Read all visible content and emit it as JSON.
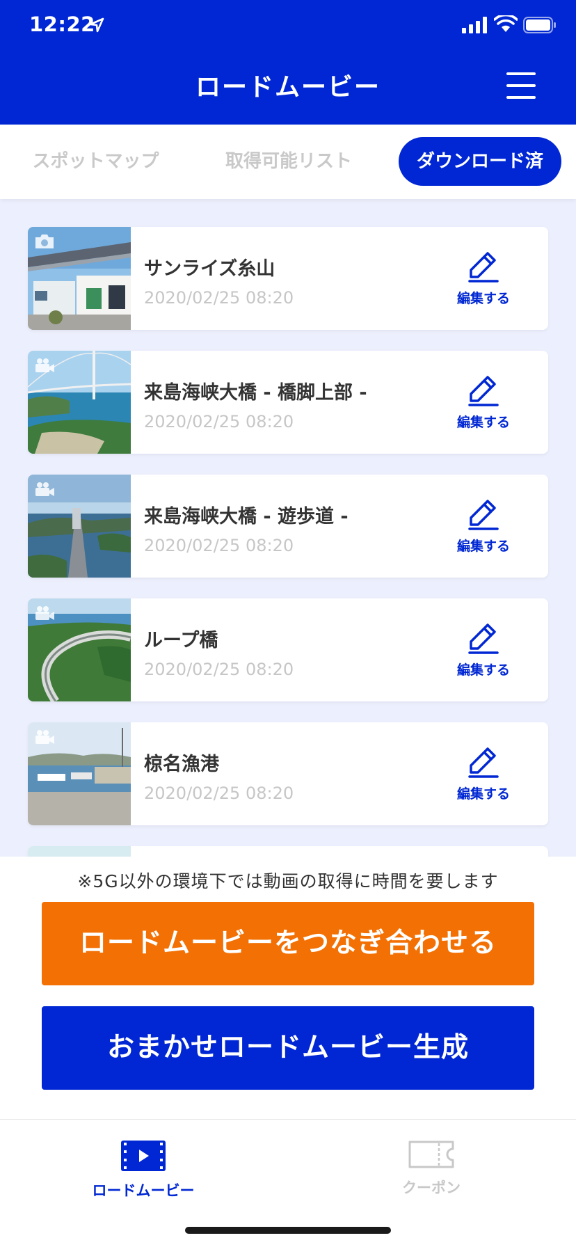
{
  "status_bar": {
    "time": "12:22"
  },
  "header": {
    "title": "ロードムービー"
  },
  "tabs": [
    {
      "label": "スポットマップ",
      "active": false
    },
    {
      "label": "取得可能リスト",
      "active": false
    },
    {
      "label": "ダウンロード済",
      "active": true
    }
  ],
  "list": {
    "edit_label": "編集する",
    "items": [
      {
        "title": "サンライズ糸山",
        "date": "2020/02/25 08:20",
        "media": "camera-icon"
      },
      {
        "title": "来島海峡大橋 - 橋脚上部 -",
        "date": "2020/02/25 08:20",
        "media": "video-camera-icon"
      },
      {
        "title": "来島海峡大橋 - 遊歩道 -",
        "date": "2020/02/25 08:20",
        "media": "video-camera-icon"
      },
      {
        "title": "ループ橋",
        "date": "2020/02/25 08:20",
        "media": "video-camera-icon"
      },
      {
        "title": "椋名漁港",
        "date": "2020/02/25 08:20",
        "media": "video-camera-icon"
      }
    ]
  },
  "notice": "※5G以外の環境下では動画の取得に時間を要します",
  "buttons": {
    "merge": "ロードムービーをつなぎ合わせる",
    "auto": "おまかせロードムービー生成"
  },
  "tab_bar": {
    "movie": "ロードムービー",
    "coupon": "クーポン"
  },
  "colors": {
    "primary": "#0027d3",
    "accent": "#f27004",
    "list_background": "#eceffd"
  }
}
